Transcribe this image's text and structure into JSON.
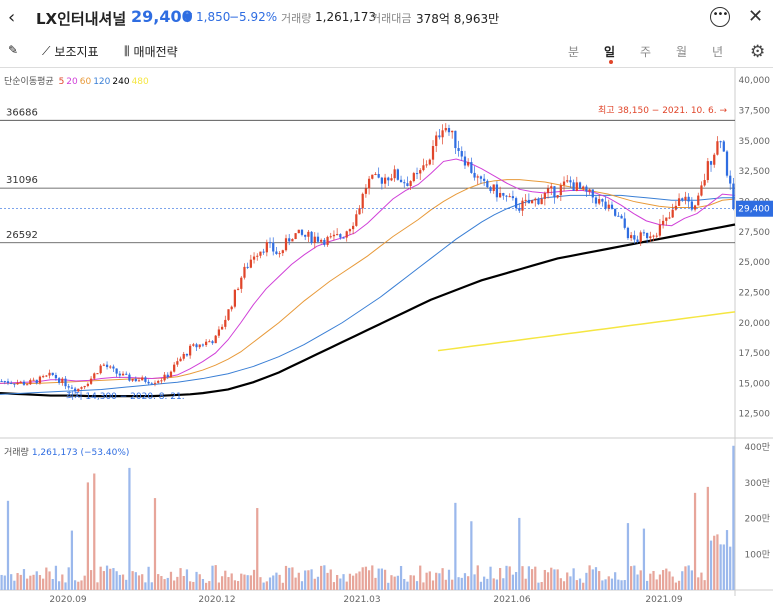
{
  "header": {
    "back_icon": "back-arrow-icon",
    "name": "LX인터내셔널",
    "price": "29,400",
    "change": "▼ 1,850",
    "rate": "−5.92%",
    "volume_label": "거래량",
    "volume": "1,261,173",
    "amount_label": "거래대금",
    "amount": "378억 8,963만",
    "price_color": "#2f6de1"
  },
  "toolbar": {
    "draw_icon": "pencil-icon",
    "indicator_label": "보조지표",
    "strategy_label": "매매전략",
    "periods": [
      "분",
      "일",
      "주",
      "월",
      "년"
    ],
    "active_period": "일"
  },
  "ma_legend": {
    "label": "단순이동평균",
    "periods": [
      {
        "label": "5",
        "color": "#e0452a"
      },
      {
        "label": "20",
        "color": "#d040d8"
      },
      {
        "label": "60",
        "color": "#e89a3a"
      },
      {
        "label": "120",
        "color": "#3a7fd5"
      },
      {
        "label": "240",
        "color": "#000000"
      },
      {
        "label": "480",
        "color": "#f5e642"
      }
    ]
  },
  "chart_data": {
    "type": "candlestick",
    "y_ticks": [
      "40,000",
      "37,500",
      "35,000",
      "32,500",
      "30,000",
      "27,500",
      "25,000",
      "22,500",
      "20,000",
      "17,500",
      "15,000",
      "12,500"
    ],
    "y_tick_values": [
      40000,
      37500,
      35000,
      32500,
      30000,
      27500,
      25000,
      22500,
      20000,
      17500,
      15000,
      12500
    ],
    "ylim": [
      10500,
      41000
    ],
    "x_ticks": [
      "2020.09",
      "2020.12",
      "2021.03",
      "2021.06",
      "2021.09"
    ],
    "h_lines": [
      {
        "label": "36686",
        "value": 36686
      },
      {
        "label": "31096",
        "value": 31096
      },
      {
        "label": "26592",
        "value": 26592
      }
    ],
    "current_price_label": "29,400",
    "current_price": 29400,
    "high_annotation": "최고 38,150 − 2021. 10. 6. →",
    "low_annotation": "최저 14,300 − 2020. 8. 21.",
    "close_trend": [
      15200,
      15100,
      15000,
      15300,
      15700,
      15000,
      14500,
      15300,
      16600,
      15900,
      15400,
      15300,
      15200,
      15500,
      16800,
      17900,
      18300,
      18700,
      21000,
      23800,
      25700,
      26400,
      25600,
      27300,
      27100,
      27000,
      26800,
      27200,
      28600,
      31600,
      31800,
      32300,
      31600,
      32000,
      33800,
      36500,
      34800,
      33000,
      31400,
      30900,
      30200,
      29600,
      29900,
      30500,
      30900,
      31600,
      30800,
      30300,
      29400,
      28500,
      26700,
      27200,
      27700,
      28700,
      30500,
      29300,
      33000,
      35500,
      29400
    ],
    "ma20": [
      15000,
      15050,
      15100,
      15150,
      15300,
      15300,
      15200,
      15250,
      15400,
      15500,
      15500,
      15450,
      15400,
      15500,
      15700,
      16200,
      16800,
      17500,
      18600,
      20000,
      21500,
      22800,
      23800,
      24800,
      25600,
      26300,
      26700,
      27000,
      27400,
      28200,
      29200,
      30200,
      30900,
      31400,
      32300,
      33300,
      33500,
      33200,
      32700,
      32100,
      31500,
      31000,
      30800,
      30700,
      30800,
      30900,
      30900,
      30700,
      30300,
      29700,
      29000,
      28400,
      28100,
      28000,
      28600,
      29000,
      29800,
      30600,
      30500
    ],
    "ma60": [
      15000,
      15000,
      15000,
      15000,
      15050,
      15100,
      15150,
      15200,
      15250,
      15300,
      15350,
      15400,
      15400,
      15450,
      15550,
      15800,
      16100,
      16500,
      17000,
      17600,
      18400,
      19200,
      20000,
      20900,
      21800,
      22600,
      23400,
      24100,
      24800,
      25500,
      26300,
      27100,
      27800,
      28500,
      29300,
      30000,
      30600,
      31100,
      31500,
      31700,
      31800,
      31800,
      31700,
      31600,
      31400,
      31200,
      31000,
      30800,
      30600,
      30300,
      30000,
      29800,
      29600,
      29500,
      29500,
      29500,
      29700,
      30100,
      30200
    ],
    "ma120": [
      14100,
      14150,
      14200,
      14250,
      14300,
      14350,
      14400,
      14450,
      14500,
      14600,
      14700,
      14800,
      14900,
      15000,
      15100,
      15250,
      15400,
      15600,
      15800,
      16100,
      16400,
      16800,
      17200,
      17700,
      18200,
      18800,
      19400,
      20000,
      20700,
      21400,
      22100,
      22900,
      23700,
      24500,
      25300,
      26100,
      26900,
      27600,
      28300,
      28900,
      29400,
      29800,
      30100,
      30300,
      30400,
      30500,
      30500,
      30500,
      30500,
      30500,
      30400,
      30300,
      30200,
      30100,
      30100,
      30100,
      30200,
      30300,
      30300
    ],
    "ma240": [
      14200,
      14150,
      14100,
      14050,
      14000,
      14000,
      14000,
      13950,
      13950,
      13950,
      13950,
      13950,
      13950,
      14000,
      14050,
      14100,
      14200,
      14350,
      14500,
      14800,
      15100,
      15500,
      15900,
      16400,
      16900,
      17400,
      17900,
      18400,
      18900,
      19400,
      19900,
      20400,
      20900,
      21400,
      21900,
      22300,
      22700,
      23100,
      23500,
      23800,
      24100,
      24400,
      24700,
      25000,
      25300,
      25500,
      25700,
      25900,
      26100,
      26300,
      26500,
      26700,
      26900,
      27100,
      27300,
      27500,
      27700,
      27900,
      28100
    ],
    "ma480": [
      17700,
      17800,
      17900,
      18000,
      18100,
      18200,
      18300,
      18400,
      18500,
      18600,
      18700,
      18800,
      18900,
      19000,
      19100,
      19200,
      19300,
      19400,
      19500,
      19600,
      19700,
      19800,
      19900,
      20000,
      20100,
      20200,
      20300,
      20400,
      20500,
      20600,
      20700,
      20800,
      20900
    ],
    "volume_label": "거래량",
    "volume_value": "1,261,173 (−53.40%)",
    "volume_ticks": [
      "400만",
      "300만",
      "200만",
      "100만"
    ],
    "volume_tick_values": [
      4000000,
      3000000,
      2000000,
      1000000
    ],
    "volume_ylim": [
      0,
      4200000
    ]
  }
}
